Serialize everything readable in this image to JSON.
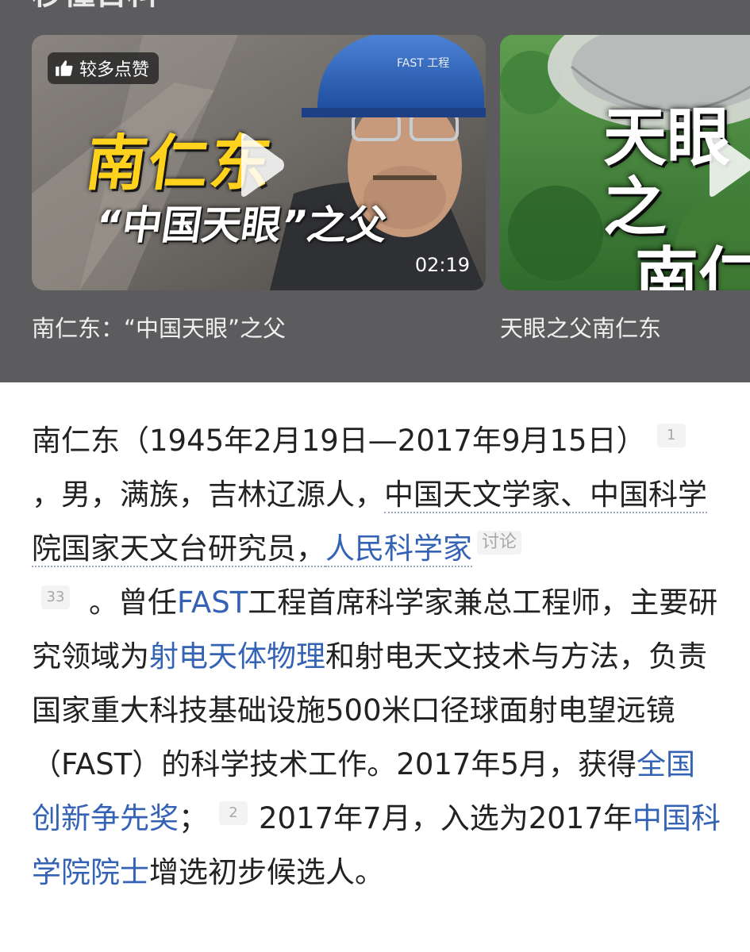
{
  "section": {
    "title": "秒懂百科"
  },
  "videos": [
    {
      "badge": "较多点赞",
      "overlay_line1": "南仁东",
      "overlay_line2": "“中国天眼”之父",
      "duration": "02:19",
      "caption": "南仁东：“中国天眼”之父"
    },
    {
      "overlay_line1": "天眼之",
      "overlay_line2": "南仁",
      "caption": "天眼之父南仁东"
    }
  ],
  "article": {
    "s1": "南仁东（1945年2月19日—2017年9月15日）",
    "ref1": "1",
    "s2": "，男，满族，吉林辽源人，",
    "link_astronomer": "中国天文学家、中国科学院国家天文台研究员，",
    "link_people_scientist": "人民科学家",
    "tag_discuss": "讨论",
    "ref33": "33",
    "s3": "。曾任",
    "link_fast": "FAST",
    "s4": "工程首席科学家兼总工程师，主要研究领域为",
    "link_radio": "射电天体物理",
    "s5": "和射电天文技术与方法，负责国家重大科技基础设施500米口径球面射电望远镜（FAST）的科学技术工作。2017年5月，获得",
    "link_award": "全国创新争先奖",
    "s6": "；",
    "ref2": "2",
    "s7": "2017年7月，入选为2017年",
    "link_cas": "中国科学院院士",
    "s8": "增选初步候选人。"
  },
  "colors": {
    "panel_bg": "#5c5c5e",
    "link": "#3463b5",
    "overlay_yellow": "#ffd21e"
  },
  "icons": [
    "thumbs-up-icon",
    "play-icon"
  ]
}
